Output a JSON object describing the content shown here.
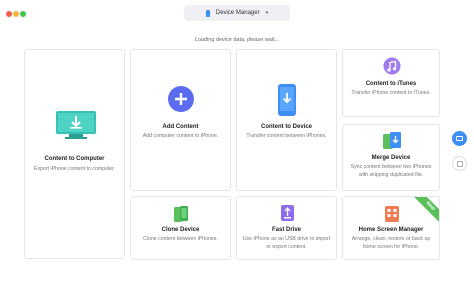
{
  "titlebar": {
    "device_selector": "Device Manager"
  },
  "loading_text": "Loading device data, please wait...",
  "cards": {
    "content_to_computer": {
      "title": "Content to Computer",
      "desc": "Export iPhone content to computer.",
      "icon": "monitor-download-icon"
    },
    "add_content": {
      "title": "Add Content",
      "desc": "Add computer content to iPhone.",
      "icon": "plus-circle-icon"
    },
    "content_to_device": {
      "title": "Content to Device",
      "desc": "Transfer content between iPhones.",
      "icon": "phone-download-icon"
    },
    "content_to_itunes": {
      "title": "Content to iTunes",
      "desc": "Transfer iPhone content to iTunes.",
      "icon": "music-note-icon"
    },
    "merge_device": {
      "title": "Merge Device",
      "desc": "Sync content between two iPhones with skipping duplicated file.",
      "icon": "merge-device-icon"
    },
    "clone_device": {
      "title": "Clone Device",
      "desc": "Clone content between iPhones.",
      "icon": "clone-phones-icon"
    },
    "fast_drive": {
      "title": "Fast Drive",
      "desc": "Use iPhone as an USB drive to import or export content.",
      "icon": "usb-drive-icon"
    },
    "home_screen_manager": {
      "title": "Home Screen Manager",
      "desc": "Arrange, clean, restore or back up home screen for iPhone.",
      "icon": "home-screen-icon",
      "badge": "New"
    }
  },
  "colors": {
    "accent": "#3d8ef5",
    "teal": "#35c2b4",
    "green": "#5bbf5b",
    "purple": "#a37bf0",
    "orange": "#f27c52"
  }
}
